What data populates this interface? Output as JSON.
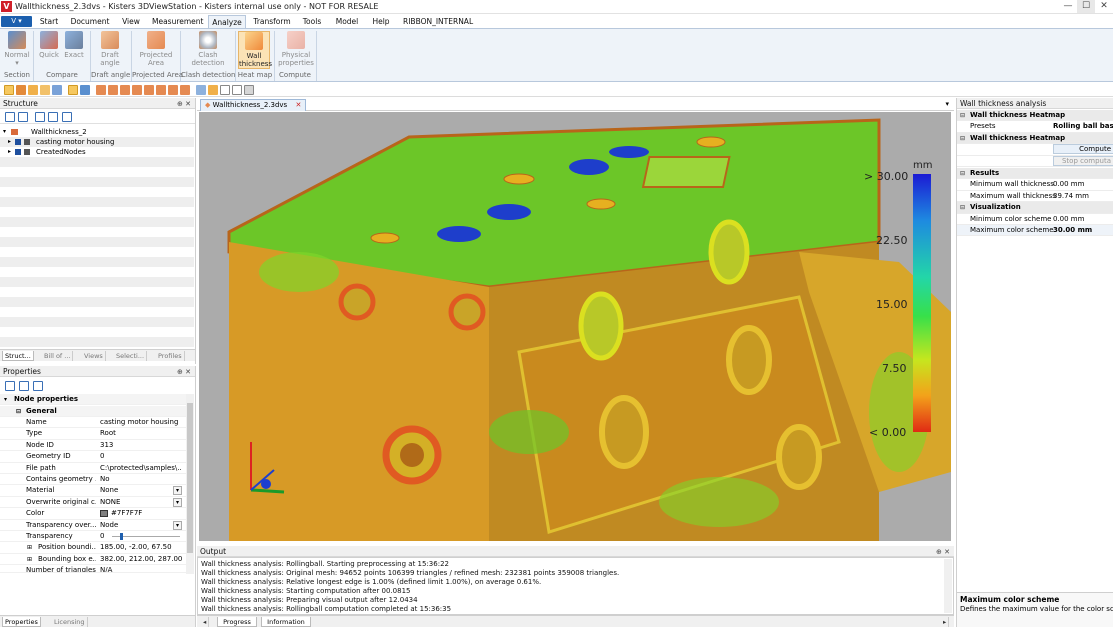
{
  "window": {
    "title": "Wallthickness_2.3dvs - Kisters 3DViewStation - Kisters internal use only - NOT FOR RESALE",
    "logo": "V",
    "minimize": "—",
    "maximize": "☐",
    "close": "✕"
  },
  "menu": {
    "app_button": "V",
    "tabs": [
      "Start",
      "Document",
      "View",
      "Measurement",
      "Analyze",
      "Transform",
      "Tools",
      "Model",
      "Help",
      "RIBBON_INTERNAL"
    ],
    "active": "Analyze"
  },
  "ribbon": {
    "buttons": [
      {
        "label": "Normal",
        "sub": "▾",
        "color": "#5a8fcf"
      },
      {
        "label": "Quick",
        "color": "#8db1dd"
      },
      {
        "label": "Exact",
        "color": "#8db1dd"
      },
      {
        "label": "Draft angle",
        "color": "#d98c5c"
      },
      {
        "label": "Projected Area",
        "color": "#e58a52"
      },
      {
        "label": "Clash detection",
        "color": "#b0b8c4"
      },
      {
        "label": "Wall thickness",
        "color": "#f08a3a"
      },
      {
        "label": "Physical properties",
        "color": "#e9b2a6"
      }
    ],
    "groups": [
      "Section",
      "Compare",
      "Draft angle",
      "Projected Area",
      "Clash detection",
      "Heat map",
      "Compute"
    ]
  },
  "structure": {
    "title": "Structure",
    "pin": "⊕ ✕",
    "items": [
      {
        "label": "Wallthickness_2",
        "level": 0
      },
      {
        "label": "casting motor housing",
        "level": 1
      },
      {
        "label": "CreatedNodes",
        "level": 1
      }
    ],
    "tabs": [
      "Struct...",
      "Bill of ...",
      "Views",
      "Selecti...",
      "Profiles"
    ]
  },
  "properties": {
    "title": "Properties",
    "section": "Node properties",
    "group": "General",
    "rows": [
      {
        "key": "Name",
        "value": "casting motor housing"
      },
      {
        "key": "Type",
        "value": "Root"
      },
      {
        "key": "Node ID",
        "value": "313"
      },
      {
        "key": "Geometry ID",
        "value": "0"
      },
      {
        "key": "File path",
        "value": "C:\\protected\\samples\\..."
      },
      {
        "key": "Contains geometry ...",
        "value": "No"
      },
      {
        "key": "Material",
        "value": "None"
      },
      {
        "key": "Overwrite original c...",
        "value": "NONE"
      },
      {
        "key": "Color",
        "value": "#7F7F7F"
      },
      {
        "key": "Transparency over...",
        "value": "Node"
      },
      {
        "key": "Transparency",
        "value": "0"
      },
      {
        "key": "Position boundi...",
        "value": "185.00, -2.00, 67.50"
      },
      {
        "key": "Bounding box e...",
        "value": "382.00, 212.00, 287.00"
      },
      {
        "key": "Number of triangles",
        "value": "N/A"
      }
    ],
    "tabs": [
      "Properties",
      "Licensing"
    ]
  },
  "document": {
    "tab": "Wallthickness_2.3dvs",
    "close": "✕"
  },
  "legend": {
    "unit": "mm",
    "ticks": [
      "> 30.00",
      "22.50",
      "15.00",
      "7.50",
      "< 0.00"
    ]
  },
  "output": {
    "title": "Output",
    "lines": [
      "Wall thickness analysis: Rollingball. Starting preprocessing at 15:36:22",
      "Wall thickness analysis: Original mesh: 94652 points 106399 triangles / refined mesh: 232381 points 359008 triangles.",
      "Wall thickness analysis: Relative longest edge is 1.00% (defined limit 1.00%), on average 0.61%.",
      "Wall thickness analysis: Starting computation after 00.0815",
      "Wall thickness analysis: Preparing visual output after 12.0434",
      "Wall thickness analysis: Rollingball computation completed at 15:36:35"
    ],
    "tabs": [
      "Progress",
      "Information"
    ]
  },
  "right_panel": {
    "title": "Wall thickness analysis",
    "heatmap_header": "Wall thickness Heatmap",
    "presets_label": "Presets",
    "presets_value": "Rolling ball based",
    "heatmap_header2": "Wall thickness Heatmap",
    "compute": "Compute",
    "stop": "Stop computa",
    "results_header": "Results",
    "min_wall_label": "Minimum wall thickness",
    "min_wall_value": "0.00 mm",
    "max_wall_label": "Maximum wall thickness",
    "max_wall_value": "39.74 mm",
    "vis_header": "Visualization",
    "min_color_label": "Minimum color scheme",
    "min_color_value": "0.00 mm",
    "max_color_label": "Maximum color scheme",
    "max_color_value": "30.00 mm",
    "help_title": "Maximum color scheme",
    "help_text": "Defines the maximum value for the color scheme"
  }
}
